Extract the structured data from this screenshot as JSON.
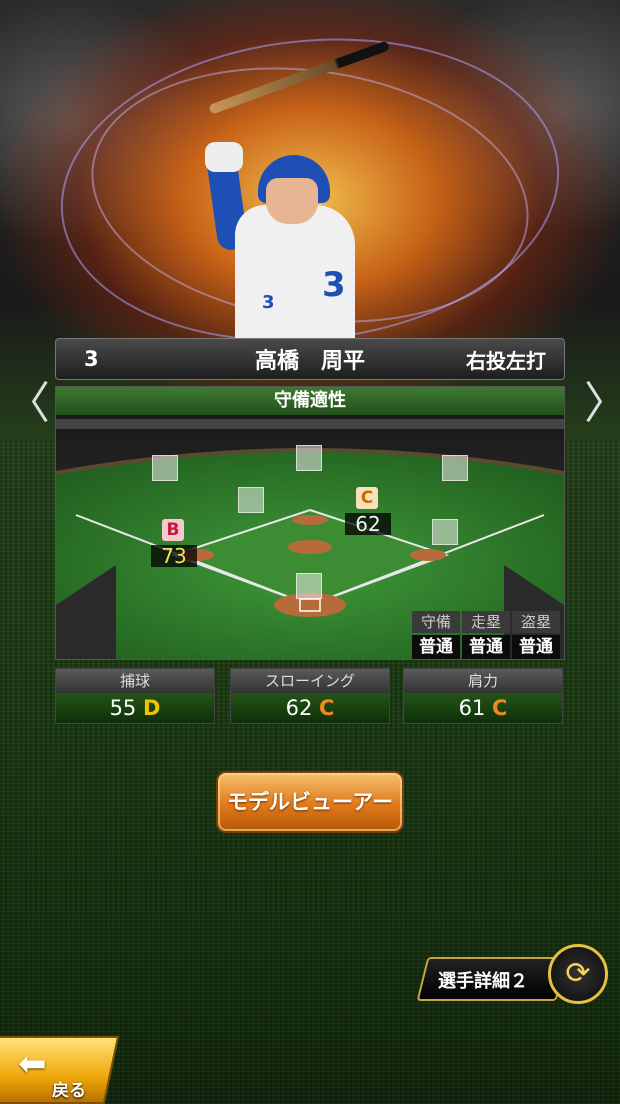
{
  "player": {
    "number": "3",
    "name": "高橋　周平",
    "handedness": "右投左打",
    "jersey_number": "3"
  },
  "nav": {
    "prev_icon": "chevron-left-icon",
    "next_icon": "chevron-right-icon",
    "prev_glyph": "〈",
    "next_glyph": "〉"
  },
  "defense": {
    "title": "守備適性",
    "positions": [
      {
        "grade": "B",
        "value": "73"
      },
      {
        "grade": "C",
        "value": "62"
      }
    ],
    "tendencies": {
      "headers": [
        "守備",
        "走塁",
        "盗塁"
      ],
      "values": [
        "普通",
        "普通",
        "普通"
      ]
    }
  },
  "stats": [
    {
      "label": "捕球",
      "value": "55",
      "grade": "D"
    },
    {
      "label": "スローイング",
      "value": "62",
      "grade": "C"
    },
    {
      "label": "肩力",
      "value": "61",
      "grade": "C"
    }
  ],
  "buttons": {
    "model_viewer": "モデルビューアー",
    "player_detail": "選手詳細２",
    "back": "戻る"
  },
  "colors": {
    "grade_b": "#c01c3c",
    "grade_c": "#f08a1c",
    "grade_d": "#f2c400",
    "accent_gold": "#e6c040"
  }
}
